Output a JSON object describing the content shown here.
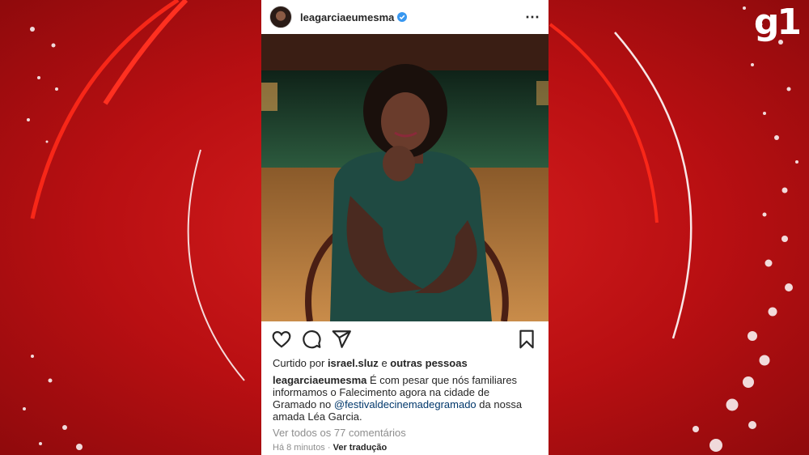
{
  "brand": {
    "logo_text": "g1",
    "background_color": "#c8141a"
  },
  "post": {
    "username": "leagarciaeumesma",
    "verified": true,
    "more_icon": "more-horizontal-icon",
    "image_subject": "Léa Garcia seated on a chair on a theater stage",
    "actions": [
      "heart-icon",
      "comment-icon",
      "share-icon",
      "bookmark-icon"
    ],
    "likes": {
      "prefix": "Curtido por",
      "user": "israel.sluz",
      "connector": "e",
      "others": "outras pessoas"
    },
    "caption": {
      "username": "leagarciaeumesma",
      "text_before": " É com pesar que nós familiares informamos o Falecimento agora na cidade de Gramado no ",
      "mention": "@festivaldecinemadegramado",
      "text_after": " da nossa amada Léa Garcia."
    },
    "comments_link": "Ver todos os 77 comentários",
    "time": "Há 8 minutos",
    "separator": "·",
    "translate": "Ver tradução"
  }
}
